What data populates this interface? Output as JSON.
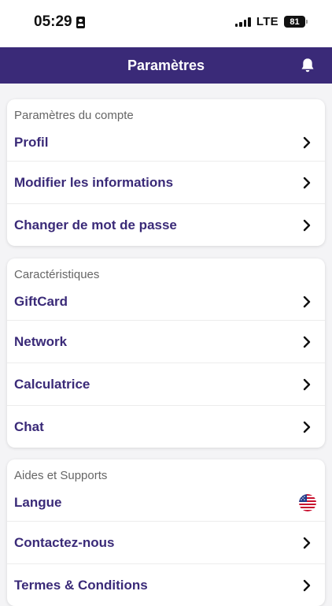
{
  "status_bar": {
    "time": "05:29",
    "network": "LTE",
    "battery": "81"
  },
  "header": {
    "title": "Paramètres"
  },
  "sections": [
    {
      "title": "Paramètres du compte",
      "items": [
        "Profil",
        "Modifier les informations",
        "Changer de mot de passe"
      ]
    },
    {
      "title": "Caractéristiques",
      "items": [
        "GiftCard",
        "Network",
        "Calculatrice",
        "Chat"
      ]
    },
    {
      "title": "Aides et Supports",
      "items": [
        "Langue",
        "Contactez-nous",
        "Termes & Conditions"
      ]
    }
  ],
  "colors": {
    "primary": "#3a2a78",
    "background": "#f4f4f6",
    "card": "#ffffff",
    "section_title": "#666666"
  },
  "icons": {
    "notification": "bell-icon",
    "language": "us-flag-icon",
    "row_action": "chevron-right-icon"
  }
}
